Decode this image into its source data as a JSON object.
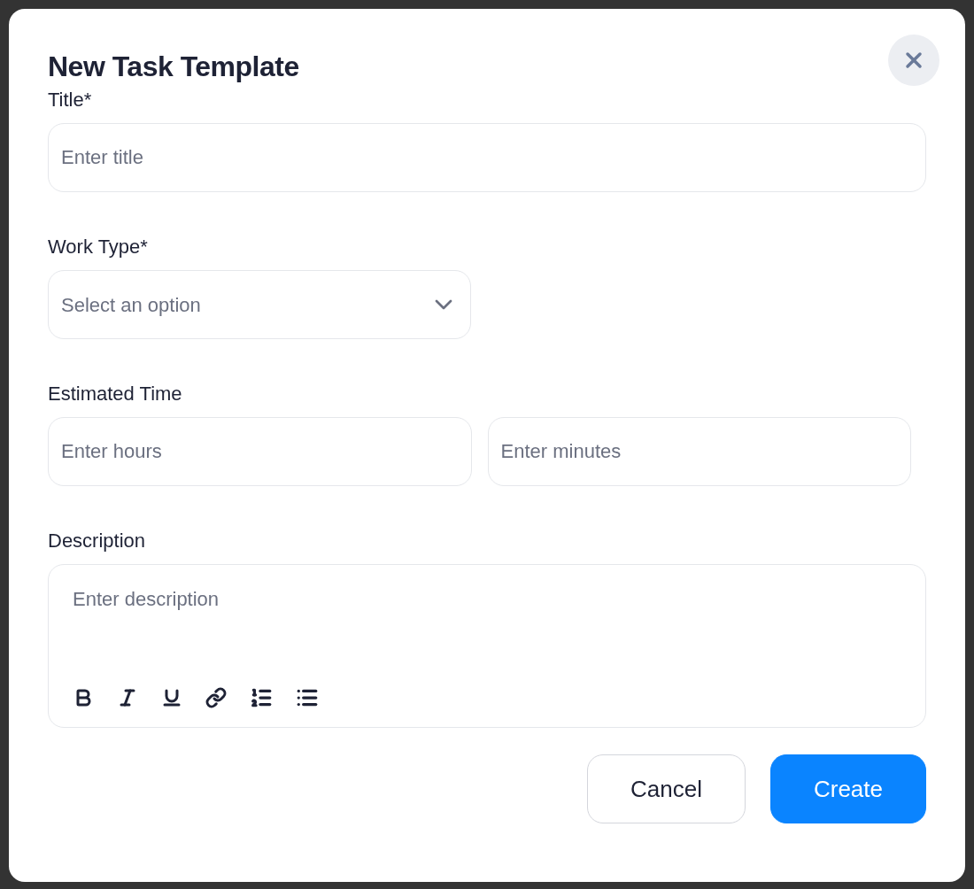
{
  "dialog": {
    "title": "New Task Template"
  },
  "fields": [
    {
      "kind": "text",
      "label": "Title*",
      "placeholder": "Enter title"
    },
    {
      "kind": "select",
      "label": "Work Type*",
      "placeholder": "Select an option"
    },
    {
      "kind": "pair",
      "label": "Estimated Time",
      "placeholders": [
        "Enter hours",
        "Enter minutes"
      ]
    },
    {
      "kind": "richtext",
      "label": "Description",
      "placeholder": "Enter description"
    }
  ],
  "buttons": [
    {
      "label": "Cancel",
      "kind": "secondary"
    },
    {
      "label": "Create",
      "kind": "primary"
    }
  ]
}
